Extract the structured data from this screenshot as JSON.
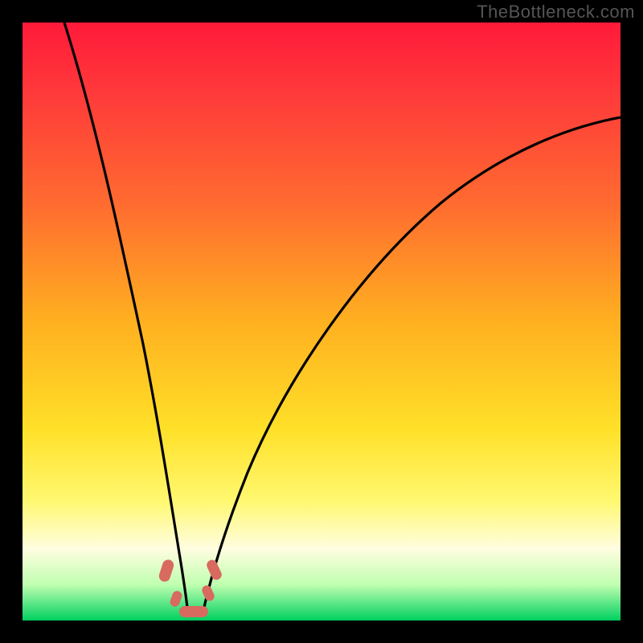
{
  "attribution": "TheBottleneck.com",
  "chart_data": {
    "type": "line",
    "title": "",
    "xlabel": "",
    "ylabel": "",
    "xlim": [
      0,
      100
    ],
    "ylim": [
      0,
      100
    ],
    "grid": false,
    "legend": false,
    "background_gradient": {
      "top_color": "#ff1a3a",
      "mid_color": "#ffe028",
      "bottom_color": "#00d060",
      "meaning": "red=high bottleneck, green=no bottleneck"
    },
    "series": [
      {
        "name": "bottleneck-curve",
        "x": [
          7,
          10,
          13,
          16,
          19,
          22,
          24,
          26,
          27,
          28,
          30,
          33,
          38,
          45,
          55,
          66,
          78,
          90,
          98
        ],
        "y": [
          100,
          88,
          75,
          60,
          45,
          28,
          14,
          5,
          1,
          1,
          5,
          15,
          30,
          45,
          58,
          68,
          75,
          80,
          83
        ]
      }
    ],
    "markers": [
      {
        "name": "marker-left-upper",
        "x": 24.0,
        "y": 8.0,
        "shape": "pill-diag"
      },
      {
        "name": "marker-left-lower",
        "x": 25.5,
        "y": 2.5,
        "shape": "pill-diag-small"
      },
      {
        "name": "marker-bottom",
        "x": 28.0,
        "y": 0.8,
        "shape": "pill-horiz"
      },
      {
        "name": "marker-right-lower",
        "x": 30.5,
        "y": 4.0,
        "shape": "pill-diag-small-r"
      },
      {
        "name": "marker-right-upper",
        "x": 31.5,
        "y": 8.5,
        "shape": "pill-diag-r"
      }
    ]
  }
}
